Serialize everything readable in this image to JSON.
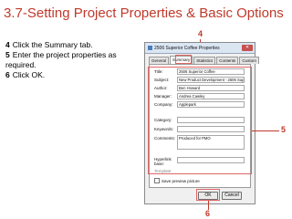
{
  "slide": {
    "title": "3.7-Setting Project Properties & Basic Options",
    "steps": [
      {
        "num": "4",
        "text": "Click the Summary tab."
      },
      {
        "num": "5",
        "text": "Enter the project properties as required."
      },
      {
        "num": "6",
        "text": "Click OK."
      }
    ],
    "callouts": {
      "c4": "4",
      "c5": "5",
      "c6": "6"
    }
  },
  "dialog": {
    "title": "2506 Superior Coffee Properties",
    "close_label": "✕",
    "tabs": [
      "General",
      "Summary",
      "Statistics",
      "Contents",
      "Custom"
    ],
    "active_tab": "Summary",
    "fields": [
      {
        "label": "Title:",
        "value": "2506 Superior Coffee"
      },
      {
        "label": "Subject:",
        "value": "New Product Development - 2506 Superior Coffee"
      },
      {
        "label": "Author:",
        "value": "Ben Howard"
      },
      {
        "label": "Manager:",
        "value": "Andrea Cawley"
      },
      {
        "label": "Company:",
        "value": "Applepark"
      },
      {
        "label": "Category:",
        "value": ""
      },
      {
        "label": "Keywords:",
        "value": ""
      },
      {
        "label": "Comments:",
        "value": "Produced for PMO"
      },
      {
        "label": "Hyperlink base:",
        "value": ""
      },
      {
        "label": "Template:",
        "value": ""
      }
    ],
    "preview_label": "Save preview picture",
    "ok_label": "OK",
    "cancel_label": "Cancel"
  },
  "colors": {
    "accent": "#c0392b",
    "highlight": "#e06666"
  }
}
